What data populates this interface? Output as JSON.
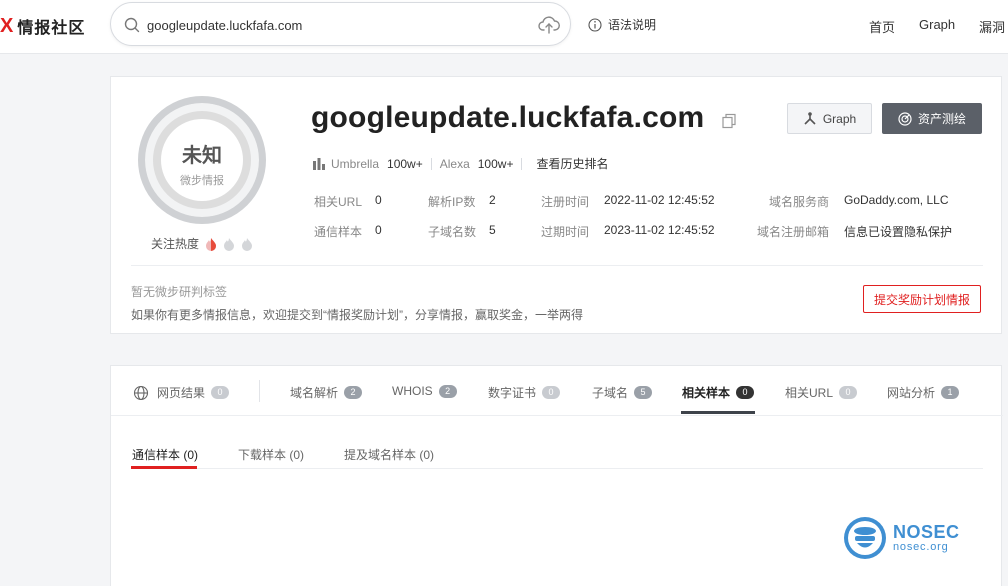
{
  "header": {
    "logo_mark": "X",
    "logo_text": "情报社区",
    "search_value": "googleupdate.luckfafa.com",
    "syntax_label": "语法说明",
    "nav": [
      "首页",
      "Graph",
      "漏洞"
    ]
  },
  "summary": {
    "verdict": "未知",
    "verdict_source": "微步情报",
    "heat_label": "关注热度",
    "domain": "googleupdate.luckfafa.com",
    "graph_button": "Graph",
    "asset_button": "资产测绘",
    "umbrella_label": "Umbrella",
    "umbrella_value": "100w+",
    "alexa_label": "Alexa",
    "alexa_value": "100w+",
    "history_link": "查看历史排名",
    "fields": {
      "related_url_label": "相关URL",
      "related_url_value": "0",
      "comm_sample_label": "通信样本",
      "comm_sample_value": "0",
      "resolve_ip_label": "解析IP数",
      "resolve_ip_value": "2",
      "subdomain_label": "子域名数",
      "subdomain_value": "5",
      "reg_time_label": "注册时间",
      "reg_time_value": "2022-11-02 12:45:52",
      "exp_time_label": "过期时间",
      "exp_time_value": "2023-11-02 12:45:52",
      "registrar_label": "域名服务商",
      "registrar_value": "GoDaddy.com, LLC",
      "reg_email_label": "域名注册邮箱",
      "reg_email_value": "信息已设置隐私保护"
    },
    "no_tag_text": "暂无微步研判标签",
    "submit_tip": "如果你有更多情报信息，欢迎提交到“情报奖励计划”，分享情报，赢取奖金，一举两得",
    "submit_button": "提交奖励计划情报"
  },
  "tabs": [
    {
      "label": "网页结果",
      "count": "0"
    },
    {
      "label": "域名解析",
      "count": "2"
    },
    {
      "label": "WHOIS",
      "count": "2"
    },
    {
      "label": "数字证书",
      "count": "0"
    },
    {
      "label": "子域名",
      "count": "5"
    },
    {
      "label": "相关样本",
      "count": "0"
    },
    {
      "label": "相关URL",
      "count": "0"
    },
    {
      "label": "网站分析",
      "count": "1"
    }
  ],
  "subtabs": [
    {
      "label": "通信样本 (0)"
    },
    {
      "label": "下载样本 (0)"
    },
    {
      "label": "提及域名样本 (0)"
    }
  ],
  "watermark": {
    "title": "NOSEC",
    "sub": "nosec.org"
  },
  "colors": {
    "brand_red": "#e02020",
    "dark_button": "#5b6068",
    "nosec_blue": "#3f8fd2"
  }
}
